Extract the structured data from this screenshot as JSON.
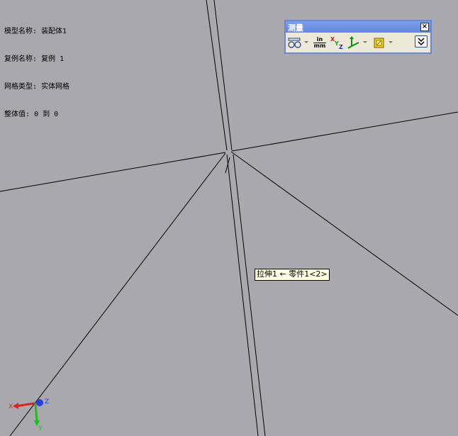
{
  "info": {
    "rows": [
      {
        "label": "模型名称:",
        "value": "装配体1"
      },
      {
        "label": "复例名称:",
        "value": "复例 1"
      },
      {
        "label": "网格类型:",
        "value": "实体网格"
      },
      {
        "label": "整体值:",
        "value": "0 到 0"
      }
    ]
  },
  "measure": {
    "title": "测量",
    "close_glyph": "×",
    "units_top": "in",
    "units_bottom": "mm",
    "tools": [
      "arc-circle-measure-icon",
      "units-precision-icon",
      "xyz-delta-icon",
      "point-to-point-axis-icon",
      "create-sensor-icon",
      "expand-icon"
    ]
  },
  "tooltip": {
    "text": "拉伸1 ← 零件1<2>"
  },
  "triad": {
    "x_label": "X",
    "y_label": "Y",
    "z_label": "Z",
    "x_color": "#e32020",
    "y_color": "#18c018",
    "z_color": "#2a3ee8"
  },
  "colors": {
    "background": "#a9a9ad",
    "edge": "#000000",
    "toolbar_border": "#6a86d6"
  }
}
